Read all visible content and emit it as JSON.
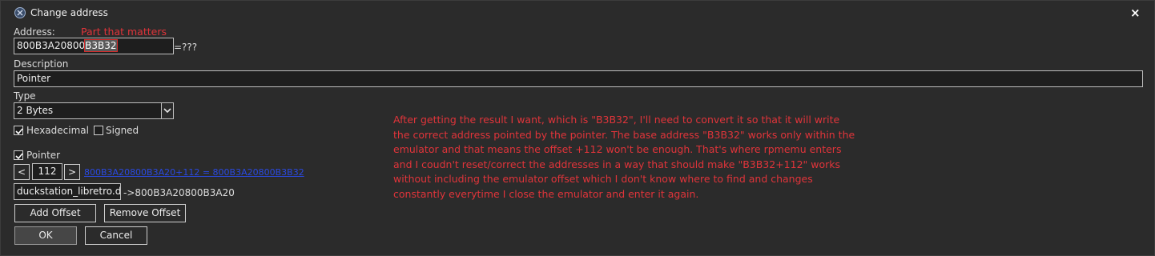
{
  "window": {
    "title": "Change address",
    "close_label": "×"
  },
  "address": {
    "label": "Address:",
    "annotation": "Part that matters",
    "value_prefix": "800B3A20800",
    "value_highlight": "B3B32",
    "result": "=???"
  },
  "description": {
    "label": "Description",
    "value": "Pointer"
  },
  "type": {
    "label": "Type",
    "value": "2 Bytes"
  },
  "options": {
    "hexadecimal_label": "Hexadecimal",
    "hexadecimal_checked": true,
    "signed_label": "Signed",
    "signed_checked": false
  },
  "pointer": {
    "label": "Pointer",
    "checked": true,
    "prev_label": "<",
    "offset": "112",
    "next_label": ">",
    "offset_link": "800B3A20800B3A20+112 = 800B3A20800B3B32",
    "base_value": "duckstation_libretro.dll+",
    "base_result": "->800B3A20800B3A20"
  },
  "buttons": {
    "add_offset": "Add Offset",
    "remove_offset": "Remove Offset",
    "ok": "OK",
    "cancel": "Cancel"
  },
  "note": {
    "lines": [
      "After getting the result I want, which is \"B3B32\", I'll need to convert it so that it will write",
      "the correct address pointed by the pointer. The base address \"B3B32\" works only within the",
      "emulator and that means the offset +112 won't be enough. That's where rpmemu enters",
      "and I coudn't reset/correct the addresses in a way that  should make \"B3B32+112\" works",
      "without including the emulator offset which I don't know where to find and changes",
      "constantly everytime I close the emulator and enter it again."
    ]
  },
  "colors": {
    "annotation": "#e0343a",
    "link": "#2a49e0",
    "background": "#2b2b2b"
  }
}
